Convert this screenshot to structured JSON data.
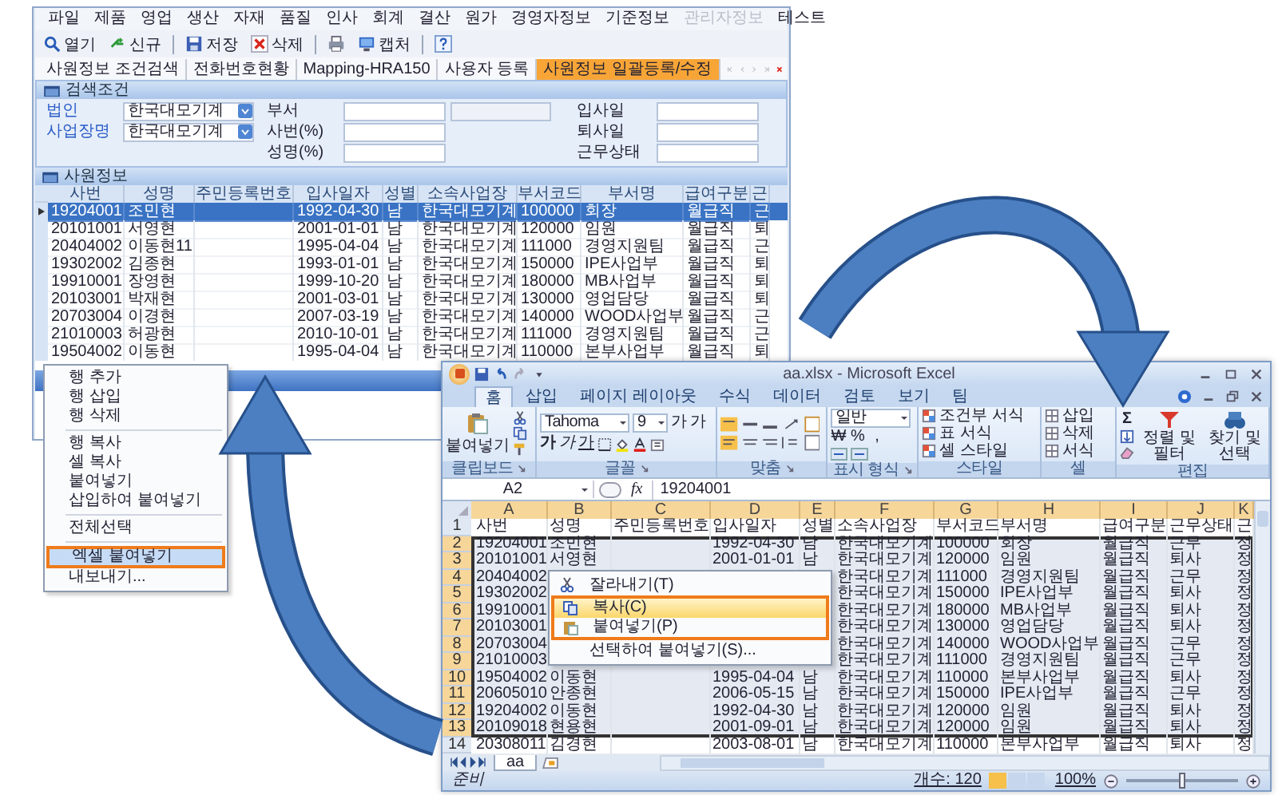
{
  "app": {
    "menu": [
      {
        "label": "파일",
        "disabled": false
      },
      {
        "label": "제품",
        "disabled": false
      },
      {
        "label": "영업",
        "disabled": false
      },
      {
        "label": "생산",
        "disabled": false
      },
      {
        "label": "자재",
        "disabled": false
      },
      {
        "label": "품질",
        "disabled": false
      },
      {
        "label": "인사",
        "disabled": false
      },
      {
        "label": "회계",
        "disabled": false
      },
      {
        "label": "결산",
        "disabled": false
      },
      {
        "label": "원가",
        "disabled": false
      },
      {
        "label": "경영자정보",
        "disabled": false
      },
      {
        "label": "기준정보",
        "disabled": false
      },
      {
        "label": "관리자정보",
        "disabled": true
      },
      {
        "label": "테스트",
        "disabled": false
      }
    ],
    "toolbar_groups": [
      [
        {
          "kind": "open",
          "label": "열기"
        },
        {
          "kind": "new",
          "label": "신규"
        }
      ],
      [
        {
          "kind": "save",
          "label": "저장"
        },
        {
          "kind": "delete",
          "label": "삭제"
        }
      ],
      [
        {
          "kind": "print"
        },
        {
          "kind": "capture",
          "label": "캡처"
        }
      ],
      [
        {
          "kind": "help"
        }
      ]
    ],
    "tabs": [
      {
        "label": "사원정보 조건검색",
        "selected": false
      },
      {
        "label": "전화번호현황",
        "selected": false
      },
      {
        "label": "Mapping-HRA150",
        "selected": false
      },
      {
        "label": "사용자 등록",
        "selected": false
      },
      {
        "label": "사원정보 일괄등록/수정",
        "selected": true
      }
    ],
    "search_panel": {
      "title": "검색조건",
      "rows": [
        {
          "left": {
            "label": "법인",
            "value": "한국대모기계"
          },
          "middle": {
            "label": "부서",
            "fields": [
              {
                "kind": "input"
              },
              {
                "kind": "readonly"
              }
            ]
          },
          "right": {
            "label": "입사일"
          }
        },
        {
          "left": {
            "label": "사업장명",
            "value": "한국대모기계"
          },
          "middle": {
            "label": "사번(%)",
            "fields": [
              {
                "kind": "input"
              }
            ]
          },
          "right": {
            "label": "퇴사일"
          }
        },
        {
          "middle": {
            "label": "성명(%)",
            "fields": [
              {
                "kind": "input"
              }
            ]
          },
          "right": {
            "label": "근무상태"
          }
        }
      ]
    },
    "table": {
      "title": "사원정보",
      "columns": [
        "사번",
        "성명",
        "주민등록번호",
        "입사일자",
        "성별",
        "소속사업장",
        "부서코드",
        "부서명",
        "급여구분",
        "근"
      ],
      "rows": [
        {
          "selected": true,
          "cells": [
            "19204001",
            "조민현",
            null,
            "1992-04-30",
            "남",
            "한국대모기계",
            "100000",
            "회장",
            "월급직",
            "근"
          ]
        },
        {
          "selected": false,
          "cells": [
            "20101001",
            "서영현",
            null,
            "2001-01-01",
            "남",
            "한국대모기계",
            "120000",
            "임원",
            "월급직",
            "퇴"
          ]
        },
        {
          "selected": false,
          "cells": [
            "20404002",
            "이동현11",
            null,
            "1995-04-04",
            "남",
            "한국대모기계",
            "111000",
            "경영지원팀",
            "월급직",
            "근"
          ]
        },
        {
          "selected": false,
          "cells": [
            "19302002",
            "김종현",
            null,
            "1993-01-01",
            "남",
            "한국대모기계",
            "150000",
            "IPE사업부",
            "월급직",
            "퇴"
          ]
        },
        {
          "selected": false,
          "cells": [
            "19910001",
            "장영현",
            null,
            "1999-10-20",
            "남",
            "한국대모기계",
            "180000",
            "MB사업부",
            "월급직",
            "퇴"
          ]
        },
        {
          "selected": false,
          "cells": [
            "20103001",
            "박재현",
            null,
            "2001-03-01",
            "남",
            "한국대모기계",
            "130000",
            "영업담당",
            "월급직",
            "퇴"
          ]
        },
        {
          "selected": false,
          "cells": [
            "20703004",
            "이경현",
            null,
            "2007-03-19",
            "남",
            "한국대모기계",
            "140000",
            "WOOD사업부",
            "월급직",
            "근"
          ]
        },
        {
          "selected": false,
          "cells": [
            "21010003",
            "허광현",
            null,
            "2010-10-01",
            "남",
            "한국대모기계",
            "111000",
            "경영지원팀",
            "월급직",
            "근"
          ]
        },
        {
          "selected": false,
          "cells": [
            "19504002",
            "이동현",
            null,
            "1995-04-04",
            "남",
            "한국대모기계",
            "110000",
            "본부사업부",
            "월급직",
            "퇴"
          ]
        }
      ]
    }
  },
  "context_menu": {
    "groups": [
      [
        {
          "label": "행 추가",
          "selected": false,
          "emphasized": false
        },
        {
          "label": "행 삽입",
          "selected": false,
          "emphasized": false
        },
        {
          "label": "행 삭제",
          "selected": false,
          "emphasized": false
        }
      ],
      [
        {
          "label": "행 복사",
          "selected": false,
          "emphasized": false
        },
        {
          "label": "셀 복사",
          "selected": false,
          "emphasized": false
        },
        {
          "label": "붙여넣기",
          "selected": false,
          "emphasized": false
        },
        {
          "label": "삽입하여 붙여넣기",
          "selected": false,
          "emphasized": false
        }
      ],
      [
        {
          "label": "전체선택",
          "selected": false,
          "emphasized": false
        }
      ],
      [
        {
          "label": "엑셀 붙여넣기",
          "selected": true,
          "emphasized": true
        },
        {
          "label": "내보내기...",
          "selected": false,
          "emphasized": false
        }
      ]
    ]
  },
  "excel": {
    "title": "aa.xlsx - Microsoft Excel",
    "ribbon_tabs": [
      {
        "label": "홈",
        "selected": true
      },
      {
        "label": "삽입",
        "selected": false
      },
      {
        "label": "페이지 레이아웃",
        "selected": false
      },
      {
        "label": "수식",
        "selected": false
      },
      {
        "label": "데이터",
        "selected": false
      },
      {
        "label": "검토",
        "selected": false
      },
      {
        "label": "보기",
        "selected": false
      },
      {
        "label": "팀",
        "selected": false
      }
    ],
    "ribbon": {
      "clipboard": {
        "paste": "붙여넣기",
        "label": "클립보드"
      },
      "font": {
        "name": "Tahoma",
        "size": "9",
        "size_buttons": [
          "가",
          "가"
        ],
        "style_buttons": [
          "가",
          "가",
          "가"
        ],
        "label": "글꼴"
      },
      "alignment": {
        "label": "맞춤"
      },
      "number": {
        "format": "일반",
        "symbols": [
          "₩",
          "%",
          ","
        ],
        "label": "표시 형식"
      },
      "styles": {
        "items": [
          "조건부 서식",
          "표 서식",
          "셀 스타일"
        ],
        "label": "스타일"
      },
      "cells": {
        "items": [
          "삽입",
          "삭제",
          "서식"
        ],
        "label": "셀"
      },
      "editing": {
        "sum": "Σ",
        "items": [
          "정렬 및 필터",
          "찾기 및 선택"
        ],
        "label": "편집"
      }
    },
    "name_box": "A2",
    "formula_icon": "fx",
    "formula": "19204001",
    "columns": [
      "A",
      "B",
      "C",
      "D",
      "E",
      "F",
      "G",
      "H",
      "I",
      "J",
      "K"
    ],
    "rows": [
      {
        "number": "1",
        "selected": false,
        "cells": [
          "사번",
          "성명",
          "주민등록번호",
          "입사일자",
          "성별",
          "소속사업장",
          "부서코드",
          "부서명",
          "급여구분",
          "근무상태",
          "근"
        ]
      },
      {
        "number": "2",
        "selected": true,
        "cells": [
          "19204001",
          "조민현",
          null,
          "1992-04-30",
          "남",
          "한국대모기계",
          "100000",
          "회장",
          "월급직",
          "근무",
          "정"
        ]
      },
      {
        "number": "3",
        "selected": true,
        "cells": [
          "20101001",
          "서영현",
          null,
          "2001-01-01",
          "남",
          "한국대모기계",
          "120000",
          "임원",
          "월급직",
          "퇴사",
          "정"
        ]
      },
      {
        "number": "4",
        "selected": true,
        "cells": [
          "20404002",
          null,
          null,
          null,
          null,
          "한국대모기계",
          "111000",
          "경영지원팀",
          "월급직",
          "근무",
          "정"
        ]
      },
      {
        "number": "5",
        "selected": true,
        "cells": [
          "19302002",
          null,
          null,
          null,
          null,
          "한국대모기계",
          "150000",
          "IPE사업부",
          "월급직",
          "퇴사",
          "정"
        ]
      },
      {
        "number": "6",
        "selected": true,
        "cells": [
          "19910001",
          null,
          null,
          null,
          null,
          "한국대모기계",
          "180000",
          "MB사업부",
          "월급직",
          "퇴사",
          "정"
        ]
      },
      {
        "number": "7",
        "selected": true,
        "cells": [
          "20103001",
          null,
          null,
          null,
          null,
          "한국대모기계",
          "130000",
          "영업담당",
          "월급직",
          "퇴사",
          "정"
        ]
      },
      {
        "number": "8",
        "selected": true,
        "cells": [
          "20703004",
          null,
          null,
          null,
          null,
          "한국대모기계",
          "140000",
          "WOOD사업부",
          "월급직",
          "근무",
          "정"
        ]
      },
      {
        "number": "9",
        "selected": true,
        "cells": [
          "21010003",
          null,
          null,
          null,
          null,
          "한국대모기계",
          "111000",
          "경영지원팀",
          "월급직",
          "근무",
          "정"
        ]
      },
      {
        "number": "10",
        "selected": true,
        "cells": [
          "19504002",
          "이동현",
          null,
          "1995-04-04",
          "남",
          "한국대모기계",
          "110000",
          "본부사업부",
          "월급직",
          "퇴사",
          "정"
        ]
      },
      {
        "number": "11",
        "selected": true,
        "cells": [
          "20605010",
          "안종현",
          null,
          "2006-05-15",
          "남",
          "한국대모기계",
          "150000",
          "IPE사업부",
          "월급직",
          "근무",
          "정"
        ]
      },
      {
        "number": "12",
        "selected": true,
        "cells": [
          "19204002",
          "이동현",
          null,
          "1992-04-30",
          "남",
          "한국대모기계",
          "120000",
          "임원",
          "월급직",
          "퇴사",
          "정"
        ]
      },
      {
        "number": "13",
        "selected": true,
        "cells": [
          "20109018",
          "현용현",
          null,
          "2001-09-01",
          "남",
          "한국대모기계",
          "120000",
          "임원",
          "월급직",
          "퇴사",
          "정"
        ]
      },
      {
        "number": "14",
        "selected": false,
        "cells": [
          "20308011",
          "김경현",
          null,
          "2003-08-01",
          "남",
          "한국대모기계",
          "110000",
          "본부사업부",
          "월급직",
          "퇴사",
          "정"
        ]
      }
    ],
    "context_menu": [
      {
        "kind": "cut",
        "label": "잘라내기(T)",
        "selected": false,
        "emphasized": false
      },
      {
        "kind": "copy",
        "label": "복사(C)",
        "selected": true,
        "emphasized": true
      },
      {
        "kind": "paste",
        "label": "붙여넣기(P)",
        "selected": false,
        "emphasized": true
      },
      {
        "kind": "plain",
        "label": "선택하여 붙여넣기(S)...",
        "selected": false,
        "emphasized": false
      }
    ],
    "sheet_tab": "aa",
    "status_bar": {
      "status": "준비",
      "count": "개수: 120",
      "zoom": "100%",
      "zoom_slider": {
        "level": 0.5
      }
    }
  }
}
